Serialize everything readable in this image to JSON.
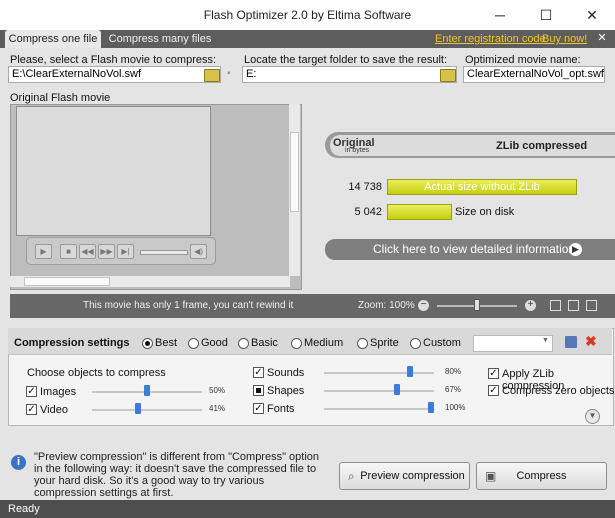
{
  "window": {
    "title": "Flash Optimizer 2.0 by Eltima Software",
    "minimize": "─",
    "maximize": "☐",
    "close": "✕"
  },
  "tabs": [
    {
      "label": "Compress one file"
    },
    {
      "label": "Compress many files"
    }
  ],
  "links": {
    "registration": "Enter registration code",
    "buy": "Buy now!",
    "close": "✕"
  },
  "source": {
    "label": "Please, select a Flash movie to compress:",
    "value": "E:\\ClearExternalNoVol.swf"
  },
  "target": {
    "label": "Locate the target folder to save the result:",
    "value": "E:"
  },
  "output": {
    "label": "Optimized movie name:",
    "value": "ClearExternalNoVol_opt.swf"
  },
  "player": {
    "label": "Original Flash movie"
  },
  "stats": {
    "header_left": "Original",
    "header_left_sub": "in bytes",
    "header_right": "ZLib compressed",
    "original_bytes": "14 738",
    "original_bar_label": "Actual size without ZLib",
    "original_fraction": 1.0,
    "zlib_bytes": "5 042",
    "zlib_bar_label": "Size on disk",
    "zlib_fraction": 0.342,
    "detail_link": "Click here to view detailed information"
  },
  "zoombar": {
    "message": "This movie has only 1 frame, you can't rewind it",
    "zoom_label": "Zoom: 100%",
    "zoom_level": 0.5
  },
  "compression": {
    "title": "Compression settings",
    "presets": [
      "Best",
      "Good",
      "Basic",
      "Medium",
      "Sprite",
      "Custom"
    ],
    "selected_preset": "Best",
    "objects_label": "Choose objects to compress",
    "objects": [
      {
        "label": "Images",
        "checked": true,
        "percent": "50%",
        "level": 0.5
      },
      {
        "label": "Video",
        "checked": true,
        "percent": "41%",
        "level": 0.41
      },
      {
        "label": "Sounds",
        "checked": true,
        "percent": "80%",
        "level": 0.8
      },
      {
        "label": "Shapes",
        "checked": "partial",
        "percent": "67%",
        "level": 0.67
      },
      {
        "label": "Fonts",
        "checked": true,
        "percent": "100%",
        "level": 1.0
      }
    ],
    "options": [
      {
        "label": "Apply ZLib compression",
        "checked": true
      },
      {
        "label": "Compress zero objects",
        "checked": true
      }
    ]
  },
  "info": {
    "text": "\"Preview compression\" is different from \"Compress\" option in the following way: it doesn't save the compressed file to your hard disk. So it's a good way to try various compression settings at first."
  },
  "buttons": {
    "preview": "Preview compression",
    "compress": "Compress"
  },
  "status": "Ready"
}
